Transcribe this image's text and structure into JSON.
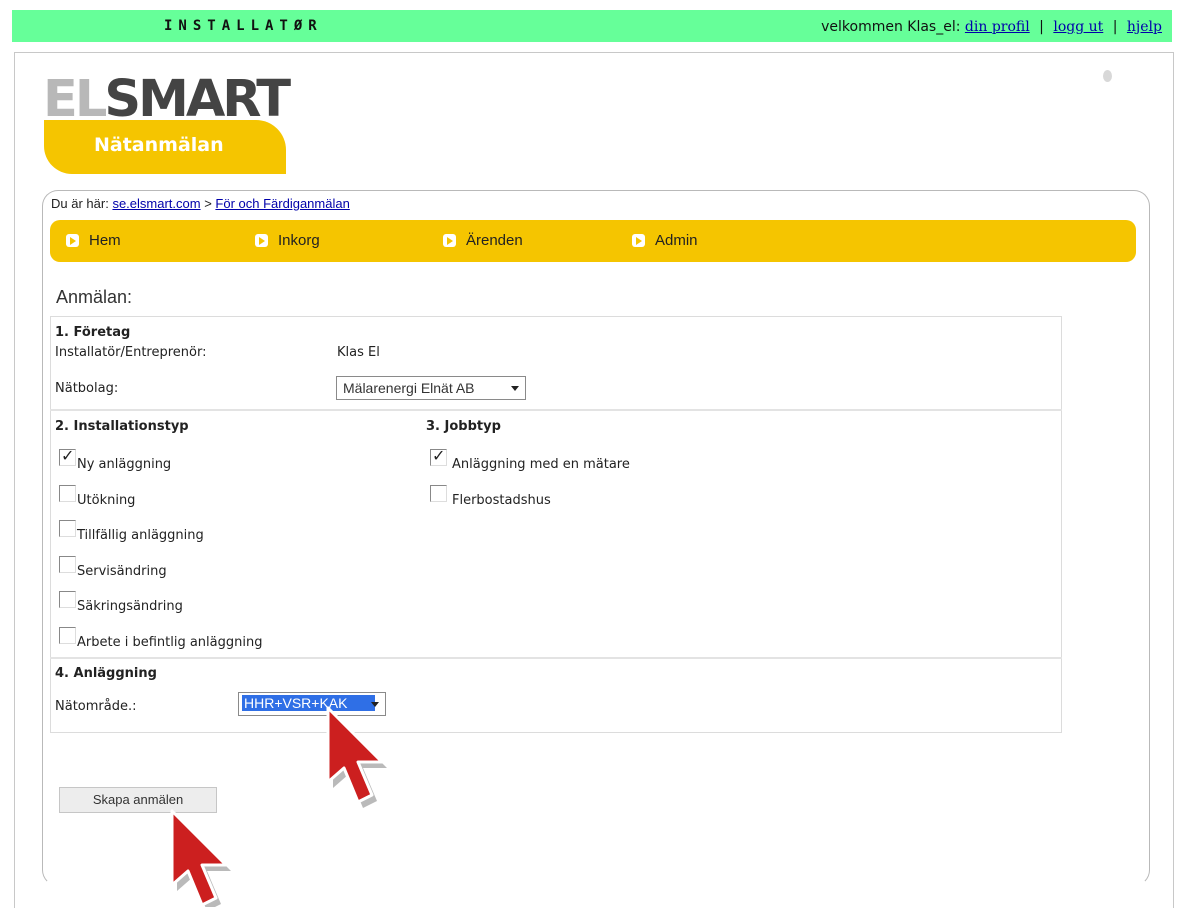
{
  "topbar": {
    "role": "INSTALLATØR",
    "welcome_prefix": "velkommen Klas_el:",
    "link_profile": "din profil",
    "link_logout": "logg ut",
    "link_help": "hjelp",
    "separator": "|"
  },
  "logo": {
    "text_el": "EL",
    "text_smart": "SMART",
    "tagline": "Nätanmälan"
  },
  "breadcrumb": {
    "prefix": "Du är här:",
    "link_home": "se.elsmart.com",
    "separator": ">",
    "link_current": "För och Färdiganmälan"
  },
  "nav": {
    "items": [
      "Hem",
      "Inkorg",
      "Ärenden",
      "Admin"
    ]
  },
  "form": {
    "title": "Anmälan:",
    "section1": {
      "title": "1. Företag",
      "installer_label": "Installatör/Entreprenör:",
      "installer_value": "Klas El",
      "grid_label": "Nätbolag:",
      "grid_value": "Mälarenergi Elnät AB"
    },
    "section2": {
      "title": "2. Installationstyp",
      "options": [
        {
          "label": "Ny anläggning",
          "checked": true
        },
        {
          "label": "Utökning",
          "checked": false
        },
        {
          "label": "Tillfällig anläggning",
          "checked": false
        },
        {
          "label": "Servisändring",
          "checked": false
        },
        {
          "label": "Säkringsändring",
          "checked": false
        },
        {
          "label": "Arbete i befintlig anläggning",
          "checked": false
        }
      ]
    },
    "section3": {
      "title": "3. Jobbtyp",
      "options": [
        {
          "label": "Anläggning med en mätare",
          "checked": true
        },
        {
          "label": "Flerbostadshus",
          "checked": false
        }
      ]
    },
    "section4": {
      "title": "4. Anläggning",
      "area_label": "Nätområde.:",
      "area_value": "HHR+VSR+KAK"
    },
    "submit_label": "Skapa anmälen"
  },
  "colors": {
    "topbar": "#66ff99",
    "accent": "#f5c500",
    "link": "#0000aa",
    "selection": "#2f6fe6",
    "cursor": "#cc1f1f"
  }
}
